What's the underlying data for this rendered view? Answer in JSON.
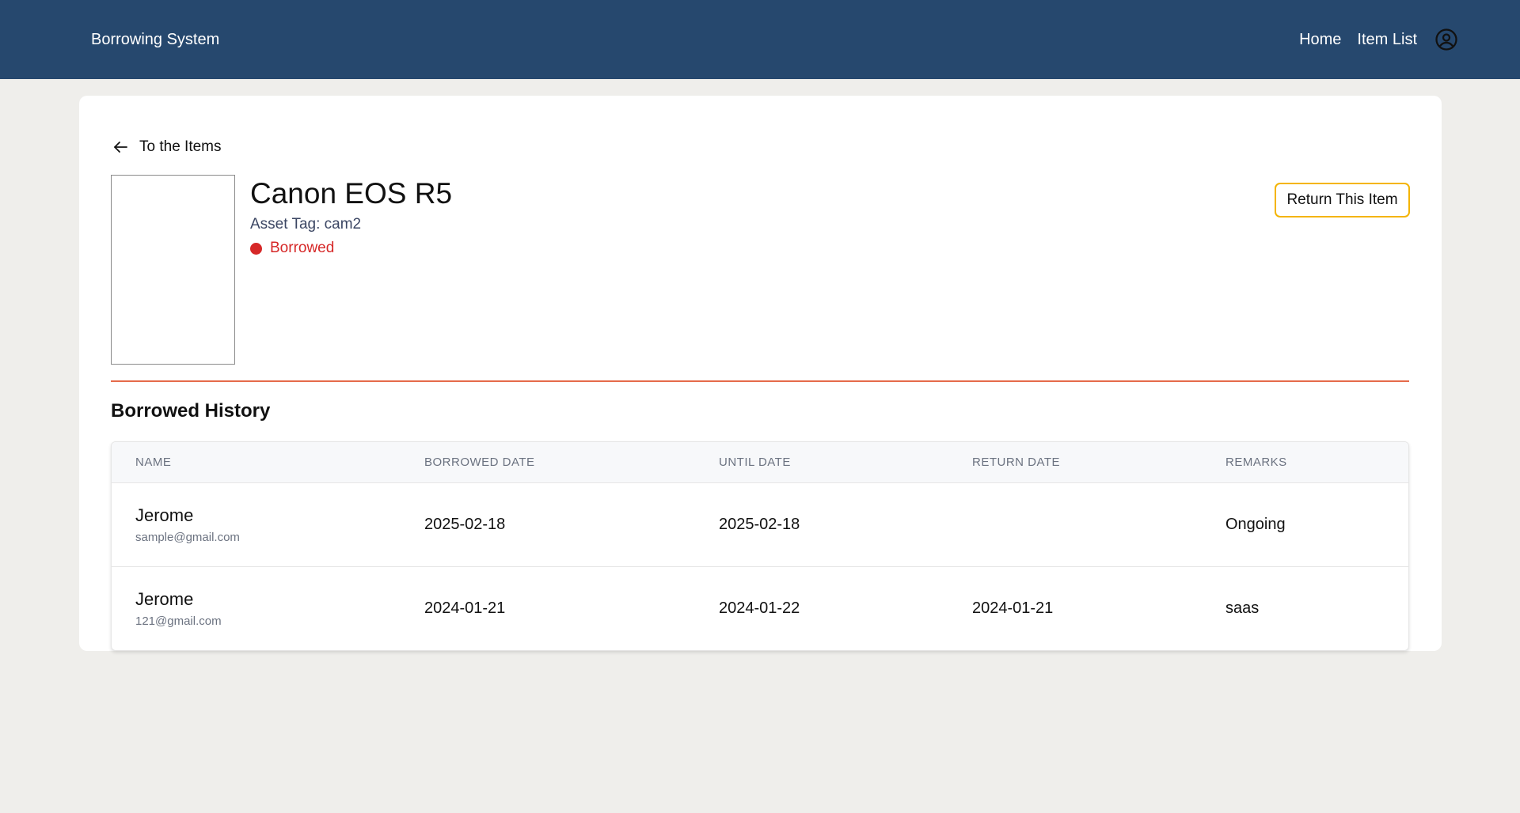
{
  "header": {
    "brand": "Borrowing System",
    "nav": [
      {
        "label": "Home"
      },
      {
        "label": "Item List"
      }
    ],
    "account_icon": "user-circle-icon"
  },
  "item": {
    "back_label": "To the Items",
    "name": "Canon EOS R5",
    "asset_tag": "Asset Tag: cam2",
    "status": "Borrowed",
    "status_color": "#d62828",
    "return_button": "Return This Item"
  },
  "history": {
    "title": "Borrowed History",
    "columns": [
      "NAME",
      "BORROWED DATE",
      "UNTIL DATE",
      "RETURN DATE",
      "REMARKS"
    ],
    "rows": [
      {
        "name": "Jerome",
        "email": "sample@gmail.com",
        "borrowed": "2025-02-18",
        "until": "2025-02-18",
        "returned": "",
        "remarks": "Ongoing"
      },
      {
        "name": "Jerome",
        "email": "121@gmail.com",
        "borrowed": "2024-01-21",
        "until": "2024-01-22",
        "returned": "2024-01-21",
        "remarks": "saas"
      }
    ]
  },
  "colors": {
    "header_bg": "#26486e",
    "accent_border": "#f4b400",
    "divider": "#e56a4a"
  }
}
